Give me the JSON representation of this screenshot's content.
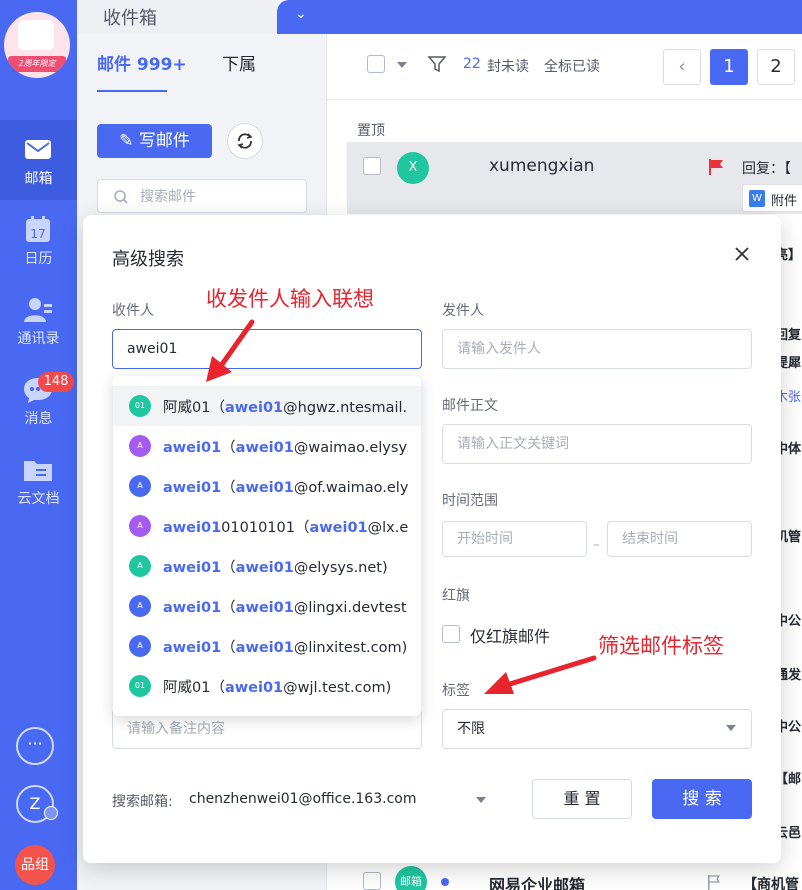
{
  "nav": {
    "logo_ribbon": "2周年限定",
    "items": [
      {
        "label": "邮箱"
      },
      {
        "label": "日历",
        "icon_text": "17"
      },
      {
        "label": "通讯录"
      },
      {
        "label": "消息",
        "badge": "148"
      },
      {
        "label": "云文档"
      }
    ],
    "more": "···",
    "user_initial": "Z",
    "app_label": "品组"
  },
  "tabs": {
    "active": "收件箱"
  },
  "folder": {
    "tab_mail": "邮件 999+",
    "tab_sub": "下属",
    "compose": "写邮件",
    "search_placeholder": "搜索邮件"
  },
  "list": {
    "unread_count": "22",
    "unread_label": "封未读",
    "mark_all": "全标已读",
    "pages": [
      "1",
      "2"
    ],
    "pinned_label": "置顶",
    "pinned_mail": {
      "avatar": "X",
      "sender": "xumengxian",
      "subject": "回复：【",
      "attachment": "附件"
    },
    "row_snippets": [
      "亮】",
      "回复",
      "提犀",
      "木张",
      "中体",
      "机管",
      "中公",
      "通发",
      "中公",
      "【邮",
      "云邑"
    ],
    "bottom_mail": {
      "avatar": "邮箱",
      "sender": "网易企业邮箱",
      "subject": "【商机管"
    }
  },
  "dialog": {
    "title": "高级搜索",
    "recipient_label": "收件人",
    "recipient_value": "awei01",
    "sender_label": "发件人",
    "sender_placeholder": "请输入发件人",
    "body_label": "邮件正文",
    "body_placeholder": "请输入正文关键词",
    "time_label": "时间范围",
    "time_start": "开始时间",
    "time_end": "结束时间",
    "flag_label": "红旗",
    "flag_option": "仅红旗邮件",
    "tag_label": "标签",
    "tag_value": "不限",
    "note_placeholder": "请输入备注内容",
    "mailbox_label": "搜索邮箱:",
    "mailbox_value": "chenzhenwei01@office.163.com",
    "reset": "重 置",
    "search": "搜 索"
  },
  "suggestions": [
    {
      "avatar": "01",
      "color": "#1fc6a0",
      "name_plain": "阿威01",
      "name_bold": "",
      "name_rest": "",
      "open": "（",
      "email_bold": "awei01",
      "email_rest": "@hgwz.ntesmail.com"
    },
    {
      "avatar": "A",
      "color": "#a55bf0",
      "name_plain": "",
      "name_bold": "awei01",
      "name_rest": "",
      "open": "（",
      "email_bold": "awei01",
      "email_rest": "@waimao.elysys.net"
    },
    {
      "avatar": "A",
      "color": "#4a69f2",
      "name_plain": "",
      "name_bold": "awei01",
      "name_rest": "",
      "open": "（",
      "email_bold": "awei01",
      "email_rest": "@of.waimao.elysys.net"
    },
    {
      "avatar": "A",
      "color": "#a55bf0",
      "name_plain": "",
      "name_bold": "awei01",
      "name_rest": "01010101",
      "open": "（",
      "email_bold": "awei01",
      "email_rest": "@lx.elysys.net"
    },
    {
      "avatar": "A",
      "color": "#1fc6a0",
      "name_plain": "",
      "name_bold": "awei01",
      "name_rest": "",
      "open": "（",
      "email_bold": "awei01",
      "email_rest": "@elysys.net)"
    },
    {
      "avatar": "A",
      "color": "#4a69f2",
      "name_plain": "",
      "name_bold": "awei01",
      "name_rest": "",
      "open": "（",
      "email_bold": "awei01",
      "email_rest": "@lingxi.devtest.com"
    },
    {
      "avatar": "A",
      "color": "#4a69f2",
      "name_plain": "",
      "name_bold": "awei01",
      "name_rest": "",
      "open": "（",
      "email_bold": "awei01",
      "email_rest": "@linxitest.com)"
    },
    {
      "avatar": "01",
      "color": "#1fc6a0",
      "name_plain": "阿威01",
      "name_bold": "",
      "name_rest": "",
      "open": "（",
      "email_bold": "awei01",
      "email_rest": "@wjl.test.com)"
    }
  ],
  "annotations": {
    "recipient_hint": "收发件人输入联想",
    "tag_hint": "筛选邮件标签"
  },
  "colors": {
    "accent": "#4a69f2",
    "annotation": "#e8242f",
    "flag": "#e8323c"
  }
}
